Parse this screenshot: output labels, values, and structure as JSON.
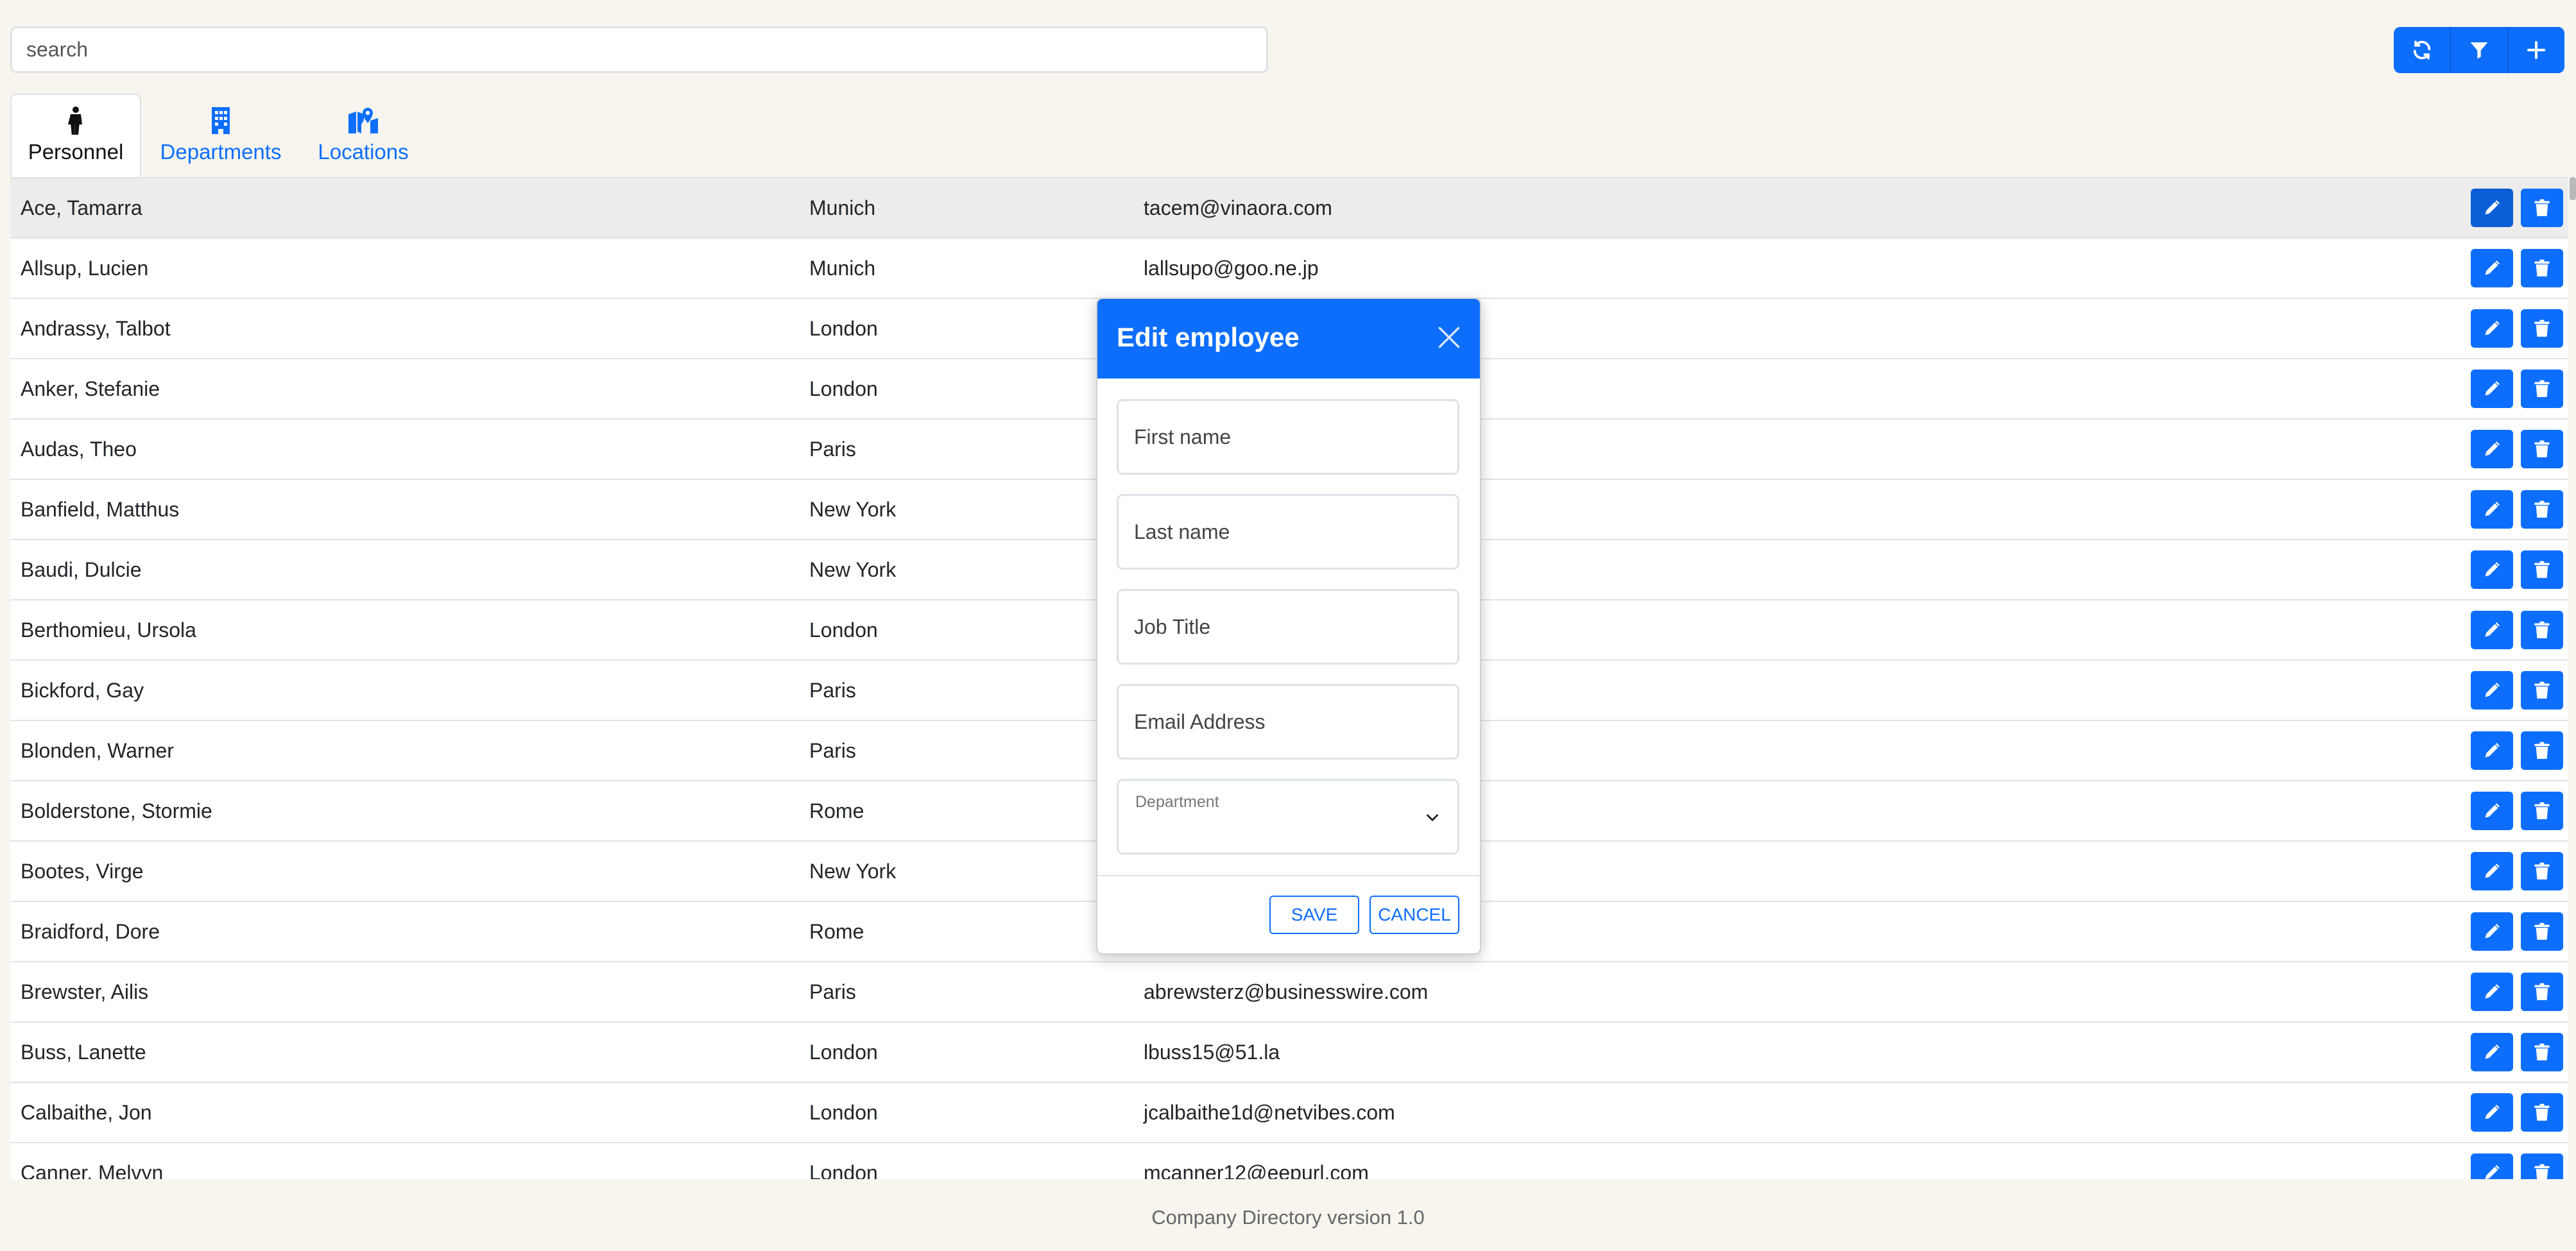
{
  "search": {
    "placeholder": "search",
    "value": ""
  },
  "toolbar": {
    "buttons": [
      "refresh-icon",
      "filter-icon",
      "plus-icon"
    ]
  },
  "tabs": [
    {
      "label": "Personnel",
      "icon": "person-icon",
      "active": true
    },
    {
      "label": "Departments",
      "icon": "building-icon",
      "active": false
    },
    {
      "label": "Locations",
      "icon": "map-icon",
      "active": false
    }
  ],
  "rows": [
    {
      "name": "Ace, Tamarra",
      "location": "Munich",
      "email": "tacem@vinaora.com"
    },
    {
      "name": "Allsup, Lucien",
      "location": "Munich",
      "email": "lallsupo@goo.ne.jp"
    },
    {
      "name": "Andrassy, Talbot",
      "location": "London",
      "email": ""
    },
    {
      "name": "Anker, Stefanie",
      "location": "London",
      "email": ""
    },
    {
      "name": "Audas, Theo",
      "location": "Paris",
      "email": ""
    },
    {
      "name": "Banfield, Matthus",
      "location": "New York",
      "email": ""
    },
    {
      "name": "Baudi, Dulcie",
      "location": "New York",
      "email": ""
    },
    {
      "name": "Berthomieu, Ursola",
      "location": "London",
      "email": ""
    },
    {
      "name": "Bickford, Gay",
      "location": "Paris",
      "email": ""
    },
    {
      "name": "Blonden, Warner",
      "location": "Paris",
      "email": ""
    },
    {
      "name": "Bolderstone, Stormie",
      "location": "Rome",
      "email": ""
    },
    {
      "name": "Bootes, Virge",
      "location": "New York",
      "email": ""
    },
    {
      "name": "Braidford, Dore",
      "location": "Rome",
      "email": ""
    },
    {
      "name": "Brewster, Ailis",
      "location": "Paris",
      "email": "abrewsterz@businesswire.com"
    },
    {
      "name": "Buss, Lanette",
      "location": "London",
      "email": "lbuss15@51.la"
    },
    {
      "name": "Calbaithe, Jon",
      "location": "London",
      "email": "jcalbaithe1d@netvibes.com"
    },
    {
      "name": "Canner, Melvyn",
      "location": "London",
      "email": "mcanner12@eepurl.com"
    }
  ],
  "modal": {
    "title": "Edit employee",
    "first_name_placeholder": "First name",
    "last_name_placeholder": "Last name",
    "job_title_placeholder": "Job Title",
    "email_placeholder": "Email Address",
    "department_label": "Department",
    "department_value": "",
    "save_label": "SAVE",
    "cancel_label": "CANCEL"
  },
  "footer": {
    "text": "Company Directory version 1.0"
  },
  "colors": {
    "accent": "#0d6efd",
    "background": "#f7f5ee"
  }
}
